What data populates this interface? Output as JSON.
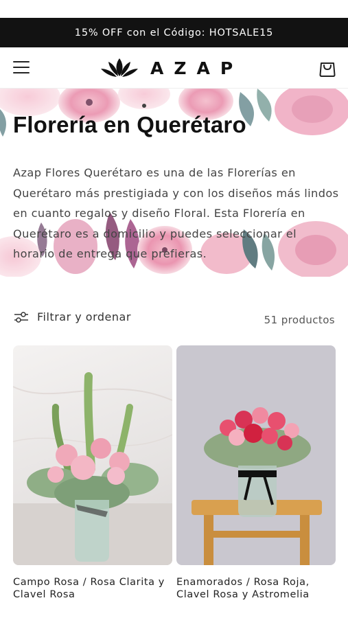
{
  "announcement": {
    "text": "15% OFF con el Código: HOTSALE15"
  },
  "header": {
    "logo_text": "AZAP",
    "menu_icon": "hamburger-menu-icon",
    "cart_icon": "shopping-bag-icon"
  },
  "hero": {
    "title": "Florería en Querétaro",
    "description": "Azap Flores Querétaro es una de las Florerías en Querétaro más prestigiada y con los diseños más lindos en cuanto regalos y diseño Floral. Esta Florería en Querétaro es a domicilio y puedes seleccionar el horario de entrega que prefieras."
  },
  "filter": {
    "label": "Filtrar y ordenar",
    "icon": "sliders-icon",
    "count": "51 productos"
  },
  "products": [
    {
      "title": "Campo Rosa / Rosa Clarita y Clavel Rosa"
    },
    {
      "title": "Enamorados / Rosa Roja, Clavel Rosa y Astromelia"
    }
  ],
  "colors": {
    "announcement_bg": "#121212",
    "accent_pink": "#e88aa8",
    "card_bg_left": "#e9e7e6",
    "card_bg_right": "#c9c7cf"
  }
}
